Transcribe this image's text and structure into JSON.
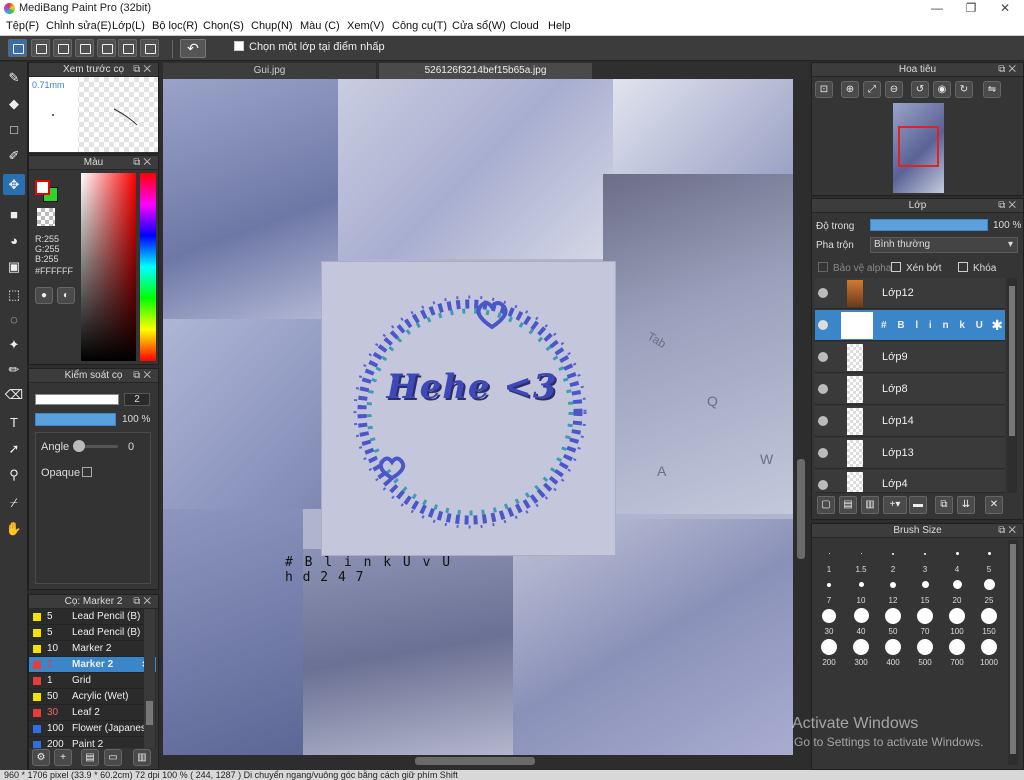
{
  "app": {
    "title": "MediBang Paint Pro (32bit)"
  },
  "window_buttons": [
    "—",
    "❐",
    "✕"
  ],
  "menu": [
    "Tệp(F)",
    "Chỉnh sửa(E)",
    "Lớp(L)",
    "Bộ lọc(R)",
    "Chọn(S)",
    "Chụp(N)",
    "Màu (C)",
    "Xem(V)",
    "Công cụ(T)",
    "Cửa sổ(W)",
    "Cloud",
    "Help"
  ],
  "toolbar": {
    "select_layer_checkbox": "Chọn một lớp tại điểm nhấp",
    "undo_glyph": "↶"
  },
  "left_tools": [
    "brush-icon",
    "eraser-icon",
    "rect-outline-icon",
    "pen-icon",
    "move-icon",
    "fill-rect-icon",
    "bucket-icon",
    "gradient-icon",
    "select-rect-icon",
    "lasso-icon",
    "magic-wand-icon",
    "select-pen-icon",
    "select-eraser-icon",
    "text-icon",
    "operation-icon",
    "eyedropper-icon",
    "divide-icon",
    "hand-icon"
  ],
  "panels": {
    "preview": {
      "title": "Xem trước cọ",
      "size": "0.71mm"
    },
    "color": {
      "title": "Màu",
      "r": "R:255",
      "g": "G:255",
      "b": "B:255",
      "hex": "#FFFFFF",
      "fg": "#ffffff",
      "bg": "#2dd42d"
    },
    "brush_control": {
      "title": "Kiểm soát cọ",
      "size": "2",
      "opacity": "100 %",
      "angle_label": "Angle",
      "angle_value": "0",
      "opaque_label": "Opaque"
    },
    "brush_list": {
      "title": "Cọ: Marker 2",
      "items": [
        {
          "size": "5",
          "name": "Lead Pencil (B)",
          "color": "#f2e300",
          "selected": false
        },
        {
          "size": "5",
          "name": "Lead Pencil (B)",
          "color": "#f2e300",
          "selected": false
        },
        {
          "size": "10",
          "name": "Marker 2",
          "color": "#f2e300",
          "selected": false
        },
        {
          "size": "2",
          "name": "Marker 2",
          "color": "#e83b3b",
          "selected": true
        },
        {
          "size": "1",
          "name": "Grid",
          "color": "#e83b3b",
          "selected": false
        },
        {
          "size": "50",
          "name": "Acrylic (Wet)",
          "color": "#f2e300",
          "selected": false
        },
        {
          "size": "30",
          "name": "Leaf 2",
          "color": "#e83b3b",
          "selected": false
        },
        {
          "size": "100",
          "name": "Flower (Japanese)",
          "color": "#2f6fe0",
          "selected": false
        },
        {
          "size": "200",
          "name": "Paint 2",
          "color": "#2f6fe0",
          "selected": false
        }
      ]
    },
    "navigator": {
      "title": "Hoa tiêu"
    },
    "layer": {
      "title": "Lớp",
      "opacity_label": "Độ trong",
      "opacity_value": "100 %",
      "blend_label": "Pha trộn",
      "blend_value": "Bình thường",
      "protect_alpha": "Bảo vệ alpha",
      "clipping": "Xén bớt",
      "lock": "Khóa",
      "layers": [
        {
          "name": "Lớp12",
          "selected": false
        },
        {
          "name": "# B l i n k U v U",
          "selected": true
        },
        {
          "name": "Lớp9",
          "selected": false
        },
        {
          "name": "Lớp8",
          "selected": false
        },
        {
          "name": "Lớp14",
          "selected": false
        },
        {
          "name": "Lớp13",
          "selected": false
        },
        {
          "name": "Lớp4",
          "selected": false
        }
      ]
    },
    "brush_size": {
      "title": "Brush Size",
      "sizes": [
        "1",
        "1.5",
        "2",
        "3",
        "4",
        "5",
        "7",
        "10",
        "12",
        "15",
        "20",
        "25",
        "30",
        "40",
        "50",
        "70",
        "100",
        "150",
        "200",
        "300",
        "400",
        "500",
        "700",
        "1000"
      ]
    }
  },
  "document_tabs": [
    {
      "label": "Gui.jpg",
      "active": false
    },
    {
      "label": "526126f3214bef15b65a.jpg",
      "active": true
    }
  ],
  "canvas": {
    "center_text": "Hehe <3",
    "watermark_line1": "# B l i n k U v U",
    "watermark_line2": "h d 2 4 7",
    "key_tab": "Tab",
    "key_q": "Q",
    "key_w": "W",
    "key_a": "A"
  },
  "status": "960 * 1706 pixel (33.9 * 60.2cm) 72 dpi 100 % ( 244, 1287 ) Di chuyển ngang/vuông góc bằng cách giữ phím Shift",
  "watermark": {
    "line1": "Activate Windows",
    "line2": "Go to Settings to activate Windows."
  }
}
